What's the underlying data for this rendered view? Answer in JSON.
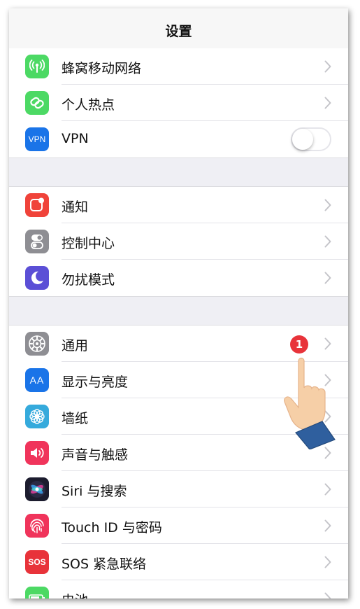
{
  "header": {
    "title": "设置"
  },
  "colors": {
    "cellular": "#4cd964",
    "hotspot": "#4cd964",
    "vpn": "#1a74e8",
    "notifications": "#f0433a",
    "control_center": "#8e8e93",
    "do_not_disturb": "#5b4fd6",
    "general": "#8e8e93",
    "display": "#1a74e8",
    "wallpaper": "#35aadc",
    "sounds": "#f0345b",
    "siri": "#1c1c2e",
    "touch_id": "#f0345b",
    "sos": "#e8333a",
    "badge": "#e8333a"
  },
  "groups": [
    {
      "items": [
        {
          "label": "蜂窝移动网络",
          "icon": "antenna-icon",
          "accessory": "chevron"
        },
        {
          "label": "个人热点",
          "icon": "hotspot-link-icon",
          "accessory": "chevron"
        },
        {
          "label": "VPN",
          "icon": "vpn-icon",
          "icon_text": "VPN",
          "accessory": "toggle",
          "toggle_on": false
        }
      ]
    },
    {
      "items": [
        {
          "label": "通知",
          "icon": "notifications-icon",
          "accessory": "chevron"
        },
        {
          "label": "控制中心",
          "icon": "control-center-icon",
          "accessory": "chevron"
        },
        {
          "label": "勿扰模式",
          "icon": "moon-icon",
          "accessory": "chevron"
        }
      ]
    },
    {
      "items": [
        {
          "label": "通用",
          "icon": "gear-icon",
          "accessory": "chevron",
          "badge": "1"
        },
        {
          "label": "显示与亮度",
          "icon": "display-brightness-icon",
          "icon_text": "AA",
          "accessory": "chevron"
        },
        {
          "label": "墙纸",
          "icon": "wallpaper-flower-icon",
          "accessory": "chevron"
        },
        {
          "label": "声音与触感",
          "icon": "speaker-icon",
          "accessory": "chevron"
        },
        {
          "label": "Siri 与搜索",
          "icon": "siri-icon",
          "accessory": "chevron"
        },
        {
          "label": "Touch ID 与密码",
          "icon": "fingerprint-icon",
          "accessory": "chevron"
        },
        {
          "label": "SOS 紧急联络",
          "icon": "sos-icon",
          "icon_text": "SOS",
          "accessory": "chevron"
        },
        {
          "label": "电池",
          "icon": "battery-icon",
          "accessory": "chevron"
        }
      ]
    }
  ],
  "overlay": {
    "pointer": "tap-hand-icon"
  }
}
